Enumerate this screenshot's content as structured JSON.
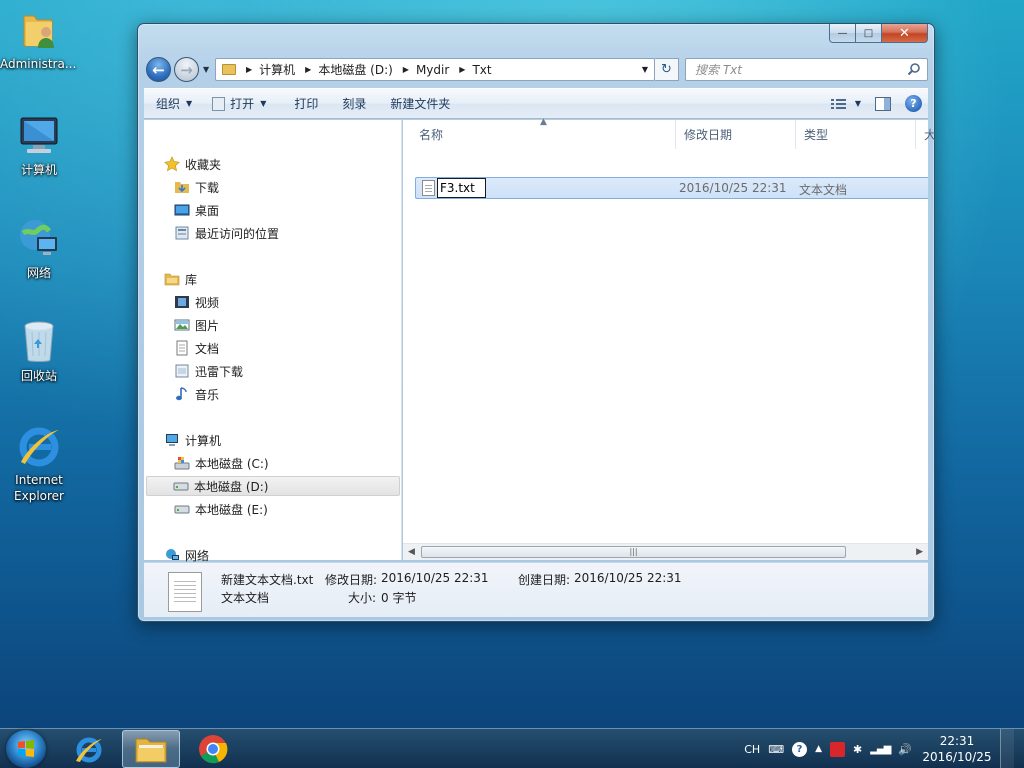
{
  "desktop": {
    "icons": [
      {
        "label": "Administra..."
      },
      {
        "label": "计算机"
      },
      {
        "label": "网络"
      },
      {
        "label": "回收站"
      },
      {
        "label": "Internet Explorer"
      }
    ]
  },
  "window": {
    "caption": {
      "minimize": "—",
      "maximize": "□",
      "close": "✕"
    },
    "address": {
      "crumbs": [
        "计算机",
        "本地磁盘 (D:)",
        "Mydir",
        "Txt"
      ]
    },
    "search": {
      "placeholder": "搜索 Txt"
    },
    "commands": {
      "organize": "组织",
      "open": "打开",
      "print": "打印",
      "burn": "刻录",
      "new_folder": "新建文件夹",
      "help": "?"
    },
    "nav": {
      "favorites": "收藏夹",
      "downloads": "下载",
      "desktop": "桌面",
      "recent": "最近访问的位置",
      "libraries": "库",
      "videos": "视频",
      "pictures": "图片",
      "documents": "文档",
      "xunlei": "迅雷下载",
      "music": "音乐",
      "computer": "计算机",
      "drive_c": "本地磁盘 (C:)",
      "drive_d": "本地磁盘 (D:)",
      "drive_e": "本地磁盘 (E:)",
      "network": "网络"
    },
    "columns": {
      "name": "名称",
      "modified": "修改日期",
      "type": "类型",
      "size": "大"
    },
    "files": [
      {
        "name_editing": "F3.txt",
        "modified": "2016/10/25 22:31",
        "type": "文本文档"
      }
    ],
    "scrollbar": {
      "grip": "|||"
    },
    "details": {
      "name": "新建文本文档.txt",
      "type": "文本文档",
      "modified_label": "修改日期:",
      "modified_value": "2016/10/25 22:31",
      "created_label": "创建日期:",
      "created_value": "2016/10/25 22:31",
      "size_label": "大小:",
      "size_value": "0 字节"
    }
  },
  "taskbar": {
    "tray": {
      "lang": "CH"
    },
    "clock": {
      "time": "22:31",
      "date": "2016/10/25"
    }
  }
}
